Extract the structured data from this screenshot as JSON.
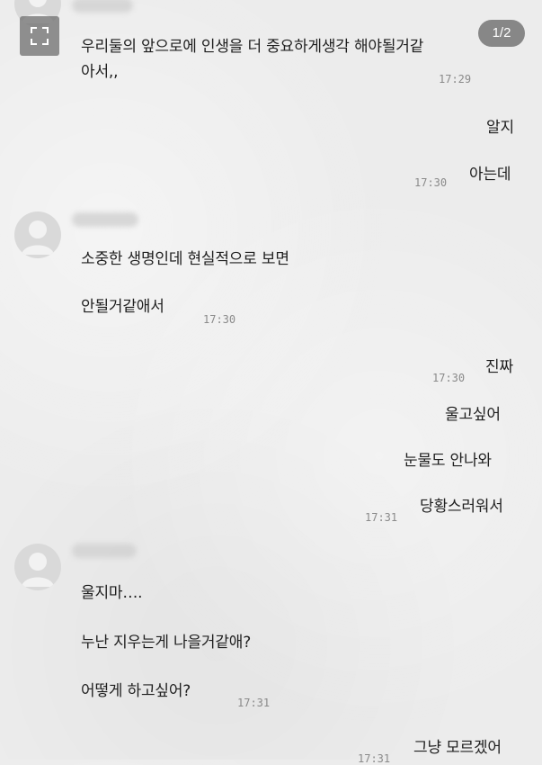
{
  "viewer": {
    "page_indicator": "1/2",
    "expand_icon": "expand-icon"
  },
  "messages": [
    {
      "side": "left",
      "text": "우리둘의 앞으로에 인생을 더 중요하게생각 해야될거같아서,,",
      "time": "17:29"
    },
    {
      "side": "right",
      "text": "알지"
    },
    {
      "side": "right",
      "text": "아는데",
      "time": "17:30"
    },
    {
      "side": "left",
      "text": "소중한 생명인데 현실적으로 보면"
    },
    {
      "side": "left",
      "text": "안될거같애서",
      "time": "17:30"
    },
    {
      "side": "right",
      "text": "진짜",
      "time": "17:30"
    },
    {
      "side": "right",
      "text": "울고싶어"
    },
    {
      "side": "right",
      "text": "눈물도 안나와"
    },
    {
      "side": "right",
      "text": "당황스러워서",
      "time": "17:31"
    },
    {
      "side": "left",
      "text": "울지마…."
    },
    {
      "side": "left",
      "text": "누난 지우는게 나을거같애?"
    },
    {
      "side": "left",
      "text": "어떻게 하고싶어?",
      "time": "17:31"
    },
    {
      "side": "right",
      "text": "그냥 모르겠어",
      "time": "17:31"
    }
  ]
}
